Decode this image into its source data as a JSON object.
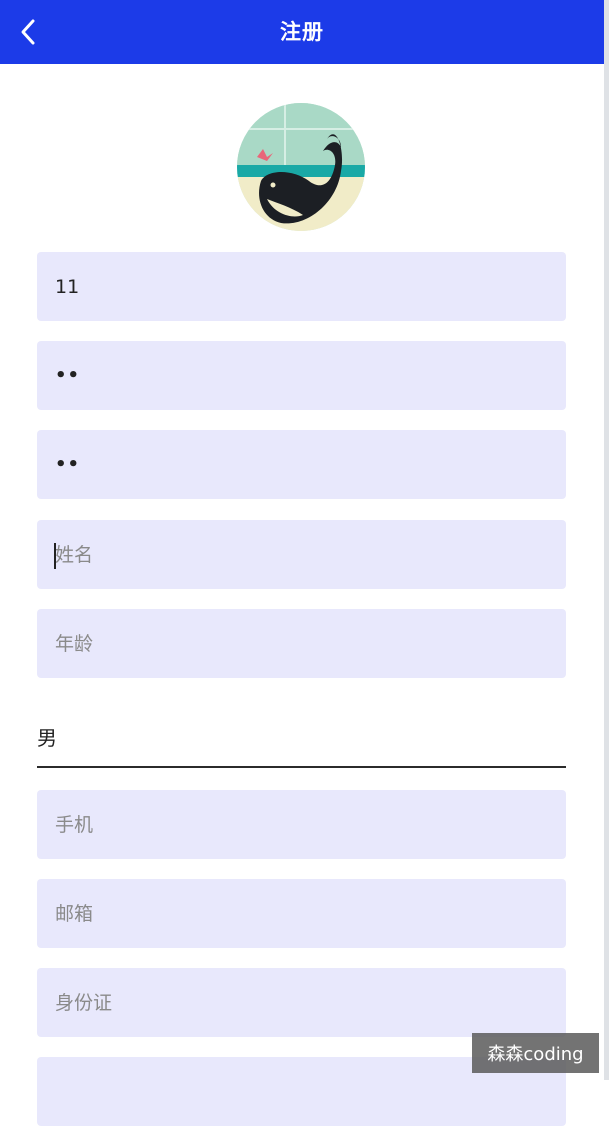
{
  "header": {
    "title": "注册",
    "back_icon": "chevron-left-icon"
  },
  "colors": {
    "accent": "#1c3be8",
    "field_bg": "#e8e8fc",
    "placeholder": "#8a8a8a"
  },
  "avatar": {
    "icon": "whale-avatar-icon"
  },
  "form": {
    "username": {
      "value": "11"
    },
    "password": {
      "value": "••"
    },
    "confirm_password": {
      "value": "••"
    },
    "name": {
      "placeholder": "姓名"
    },
    "age": {
      "placeholder": "年龄"
    },
    "gender": {
      "value": "男"
    },
    "phone": {
      "placeholder": "手机"
    },
    "email": {
      "placeholder": "邮箱"
    },
    "id_card": {
      "placeholder": "身份证"
    }
  },
  "watermark": "森森coding"
}
